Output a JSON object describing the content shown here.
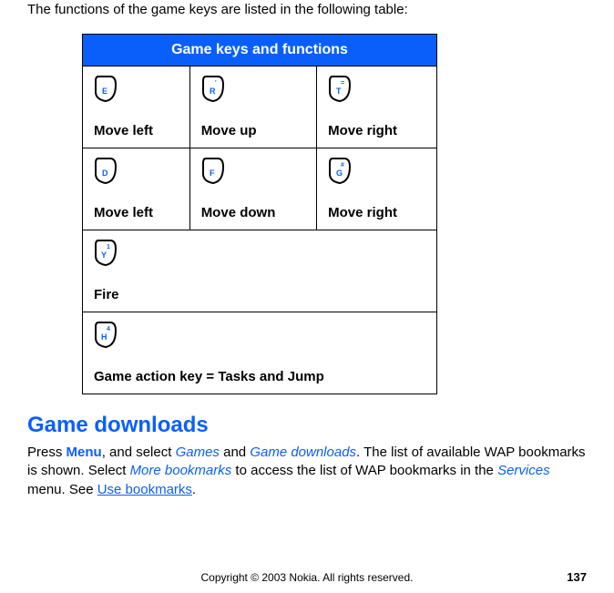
{
  "intro_text": "The functions of the game keys are listed in the following table:",
  "table": {
    "header": "Game keys and functions",
    "rows": [
      [
        {
          "key_label": "E",
          "key_sup": "",
          "text": "Move left"
        },
        {
          "key_label": "R",
          "key_sup": "'",
          "text": "Move up"
        },
        {
          "key_label": "T",
          "key_sup": "=",
          "text": "Move right"
        }
      ],
      [
        {
          "key_label": "D",
          "key_sup": "",
          "text": "Move left"
        },
        {
          "key_label": "F",
          "key_sup": "",
          "text": "Move down"
        },
        {
          "key_label": "G",
          "key_sup": "#",
          "text": "Move right"
        }
      ],
      [
        {
          "key_label": "Y",
          "key_sup": "1",
          "text": "Fire"
        }
      ],
      [
        {
          "key_label": "H",
          "key_sup": "4",
          "text": "Game action key = Tasks and Jump"
        }
      ]
    ]
  },
  "section_heading": "Game downloads",
  "paragraph": {
    "p1": "Press ",
    "menu": "Menu",
    "p2": ", and select ",
    "games": "Games",
    "p3": " and ",
    "game_downloads": "Game downloads",
    "p4": ". The list of available WAP bookmarks is shown. Select ",
    "more_bookmarks": "More bookmarks",
    "p5": " to access the list of WAP bookmarks in the ",
    "services": "Services",
    "p6": " menu. See ",
    "use_bookmarks": "Use bookmarks",
    "p7": "."
  },
  "footer_text": "Copyright © 2003 Nokia. All rights reserved.",
  "page_number": "137"
}
